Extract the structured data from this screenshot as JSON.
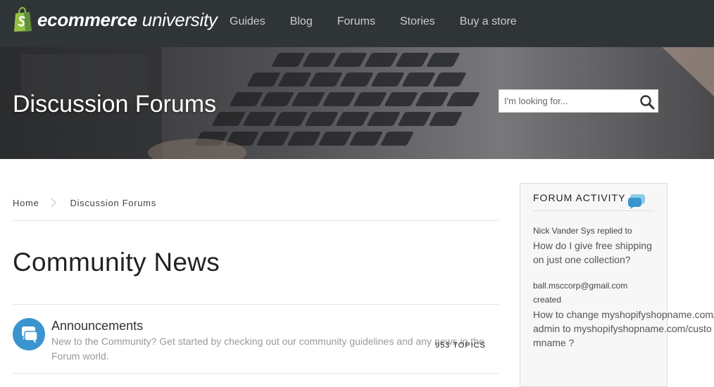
{
  "nav": {
    "logo_bold": "ecommerce",
    "logo_light": "university",
    "links": [
      "Guides",
      "Blog",
      "Forums",
      "Stories",
      "Buy a store"
    ]
  },
  "hero": {
    "title": "Discussion Forums",
    "search_placeholder": "I'm looking for..."
  },
  "breadcrumb": [
    "Home",
    "Discussion Forums"
  ],
  "section": {
    "title": "Community News"
  },
  "forums": [
    {
      "name": "Announcements",
      "description": "New to the Community? Get started by checking out our community guidelines and any news in the Forum world.",
      "topics": "953 TOPICS"
    }
  ],
  "sidebar": {
    "heading": "FORUM ACTIVITY",
    "activities": [
      {
        "meta": "Nick Vander Sys replied to",
        "link": "How do I give free shipping on just one collection?"
      },
      {
        "meta": "ball.msccorp@gmail.com created",
        "link": "How to change myshopifyshopname.com/admin to myshopifyshopname.com/customname ?"
      }
    ]
  },
  "colors": {
    "nav_bg": "#2f3437",
    "accent_blue": "#3a95cf",
    "logo_green": "#95bf47"
  }
}
